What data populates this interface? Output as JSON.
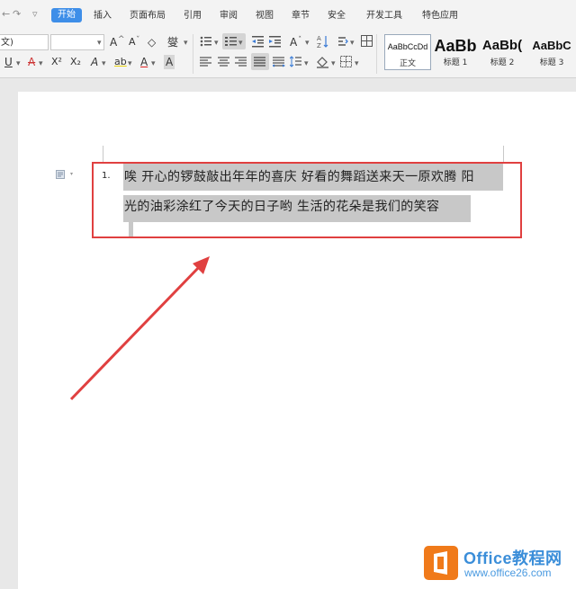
{
  "quick_access": {
    "undo_arrow": "←",
    "redo_arrow": "↷",
    "customize": "▿"
  },
  "tabs": [
    {
      "label": "开始",
      "active": true
    },
    {
      "label": "插入"
    },
    {
      "label": "页面布局"
    },
    {
      "label": "引用"
    },
    {
      "label": "审阅"
    },
    {
      "label": "视图"
    },
    {
      "label": "章节"
    },
    {
      "label": "安全"
    },
    {
      "label": "开发工具"
    },
    {
      "label": "特色应用"
    }
  ],
  "ribbon": {
    "font_name": "文)",
    "font_size": "",
    "grow_font": "A",
    "shrink_font": "A",
    "clear_format": "◇",
    "phonetic": "燮",
    "underline": "U",
    "strikethrough": "A",
    "superscript": "X²",
    "subscript": "X₂",
    "text_effect": "A",
    "highlight": "ab",
    "font_color": "A",
    "char_shading": "A",
    "styles": [
      {
        "sample": "AaBbCcDd",
        "name": "正文",
        "selected": true
      },
      {
        "sample": "AaBb",
        "name": "标题 1"
      },
      {
        "sample": "AaBb(",
        "name": "标题 2"
      },
      {
        "sample": "AaBbC",
        "name": "标题 3"
      }
    ]
  },
  "document": {
    "list_number": "1.",
    "lines": [
      "唉 开心的锣鼓敲出年年的喜庆 好看的舞蹈送来天一原欢腾 阳",
      "光的油彩涂红了今天的日子哟 生活的花朵是我们的笑容"
    ]
  },
  "watermark": {
    "title": "Office教程网",
    "url": "www.office26.com"
  },
  "colors": {
    "active_tab": "#3e8ee8",
    "highlight_box": "#e04040",
    "arrow": "#e04040",
    "selection": "#c8c8c8",
    "watermark_blue": "#3b8ed9",
    "watermark_orange": "#f07a1a"
  }
}
